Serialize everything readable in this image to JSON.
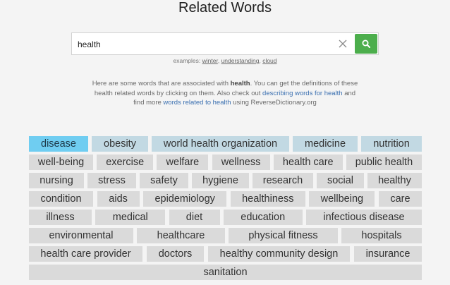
{
  "page": {
    "title": "Related Words"
  },
  "search": {
    "value": "health",
    "clear_icon": "close-icon",
    "button_icon": "search-icon",
    "button_color": "#4cae4c"
  },
  "examples": {
    "prefix": "examples:",
    "items": [
      "winter",
      "understanding",
      "cloud"
    ]
  },
  "description": {
    "part1": "Here are some words that are associated with ",
    "keyword": "health",
    "part2": ". You can get the definitions of these health related words by clicking on them. Also check out ",
    "link1": "describing words for health",
    "part3": " and find more ",
    "link2": "words related to health",
    "part4": " using ReverseDictionary.org"
  },
  "colors": {
    "active": "#6fcdf1",
    "strong": "#c2d9e3",
    "default": "#dadada"
  },
  "tag_rows": [
    [
      {
        "label": "disease",
        "style": "active"
      },
      {
        "label": "obesity",
        "style": "strong"
      },
      {
        "label": "world health organization",
        "style": "strong"
      },
      {
        "label": "medicine",
        "style": "strong"
      },
      {
        "label": "nutrition",
        "style": "strong"
      }
    ],
    [
      {
        "label": "well-being",
        "style": "default"
      },
      {
        "label": "exercise",
        "style": "default"
      },
      {
        "label": "welfare",
        "style": "default"
      },
      {
        "label": "wellness",
        "style": "default"
      },
      {
        "label": "health care",
        "style": "default"
      },
      {
        "label": "public health",
        "style": "default"
      }
    ],
    [
      {
        "label": "nursing",
        "style": "default"
      },
      {
        "label": "stress",
        "style": "default"
      },
      {
        "label": "safety",
        "style": "default"
      },
      {
        "label": "hygiene",
        "style": "default"
      },
      {
        "label": "research",
        "style": "default"
      },
      {
        "label": "social",
        "style": "default"
      },
      {
        "label": "healthy",
        "style": "default"
      }
    ],
    [
      {
        "label": "condition",
        "style": "default"
      },
      {
        "label": "aids",
        "style": "default"
      },
      {
        "label": "epidemiology",
        "style": "default"
      },
      {
        "label": "healthiness",
        "style": "default"
      },
      {
        "label": "wellbeing",
        "style": "default"
      },
      {
        "label": "care",
        "style": "default"
      }
    ],
    [
      {
        "label": "illness",
        "style": "default"
      },
      {
        "label": "medical",
        "style": "default"
      },
      {
        "label": "diet",
        "style": "default"
      },
      {
        "label": "education",
        "style": "default"
      },
      {
        "label": "infectious disease",
        "style": "default"
      }
    ],
    [
      {
        "label": "environmental",
        "style": "default"
      },
      {
        "label": "healthcare",
        "style": "default"
      },
      {
        "label": "physical fitness",
        "style": "default"
      },
      {
        "label": "hospitals",
        "style": "default"
      }
    ],
    [
      {
        "label": "health care provider",
        "style": "default"
      },
      {
        "label": "doctors",
        "style": "default"
      },
      {
        "label": "healthy community design",
        "style": "default"
      },
      {
        "label": "insurance",
        "style": "default"
      }
    ],
    [
      {
        "label": "sanitation",
        "style": "default"
      }
    ]
  ]
}
